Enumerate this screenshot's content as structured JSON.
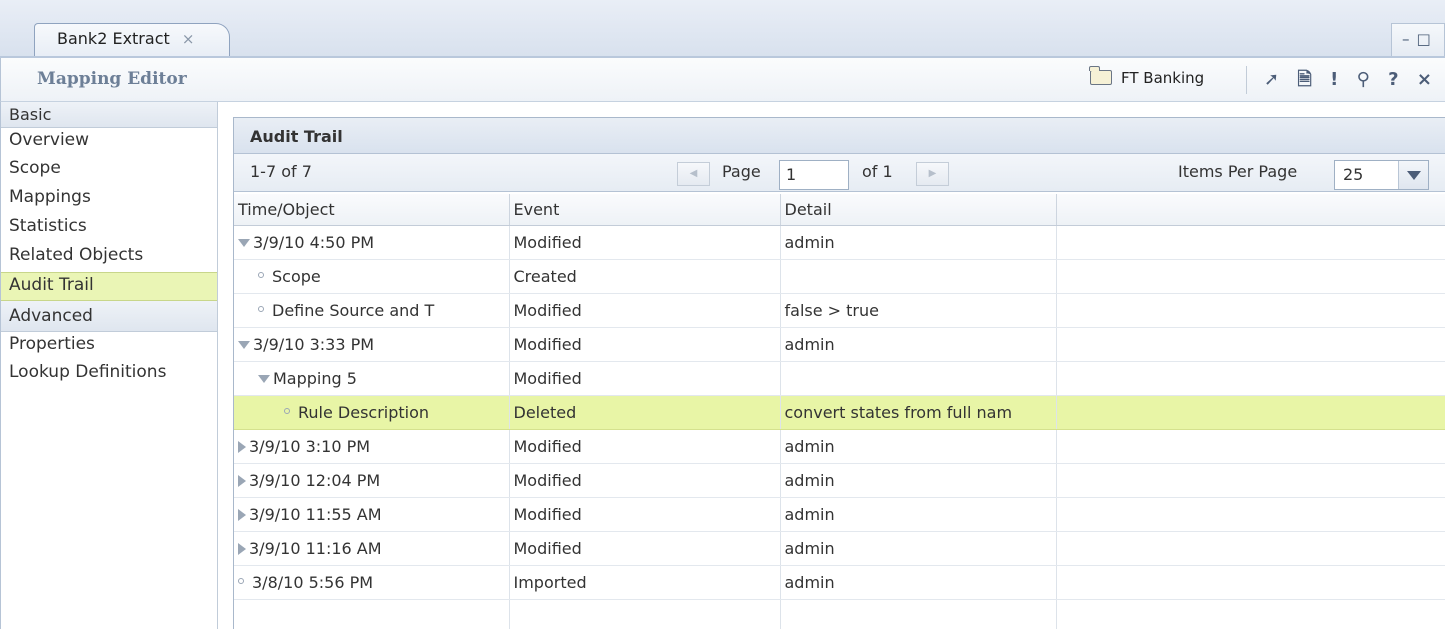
{
  "tab": {
    "title": "Bank2 Extract",
    "close_glyph": "×"
  },
  "window": {
    "minimize_glyph": "–",
    "maximize_glyph": "□"
  },
  "editor": {
    "title": "Mapping Editor",
    "project": "FT Banking",
    "tools": [
      {
        "icon": "arrow-icon",
        "glyph": "➚"
      },
      {
        "icon": "document-icon",
        "glyph": "🗎"
      },
      {
        "icon": "exclamation-icon",
        "glyph": "!"
      },
      {
        "icon": "search-icon",
        "glyph": "⚲"
      },
      {
        "icon": "help-icon",
        "glyph": "?"
      },
      {
        "icon": "close-icon",
        "glyph": "×"
      }
    ]
  },
  "sidebar": {
    "basic_header": "Basic",
    "basic_items": [
      "Overview",
      "Scope",
      "Mappings",
      "Statistics",
      "Related Objects",
      "Audit Trail"
    ],
    "selected": "Audit Trail",
    "advanced_header": "Advanced",
    "advanced_items": [
      "Properties",
      "Lookup Definitions"
    ]
  },
  "panel": {
    "title": "Audit Trail",
    "range": "1-7 of 7",
    "page_label": "Page",
    "page_value": "1",
    "of_label": "of 1",
    "ipp_label": "Items Per Page",
    "ipp_value": "25"
  },
  "grid": {
    "columns": [
      "Time/Object",
      "Event",
      "Detail",
      ""
    ],
    "rows": [
      {
        "time": "3/9/10 4:50 PM",
        "event": "Modified",
        "detail": "admin",
        "level": 0,
        "marker": "expanded"
      },
      {
        "time": "Scope",
        "event": "Created",
        "detail": "",
        "level": 1,
        "marker": "leaf"
      },
      {
        "time": "Define Source and T",
        "event": "Modified",
        "detail": "false > true",
        "level": 1,
        "marker": "leaf"
      },
      {
        "time": "3/9/10 3:33 PM",
        "event": "Modified",
        "detail": "admin",
        "level": 0,
        "marker": "expanded"
      },
      {
        "time": "Mapping 5",
        "event": "Modified",
        "detail": "",
        "level": 1,
        "marker": "expanded"
      },
      {
        "time": "Rule Description",
        "event": "Deleted",
        "detail": "convert states from full nam",
        "level": 2,
        "marker": "leaf",
        "highlight": true
      },
      {
        "time": "3/9/10 3:10 PM",
        "event": "Modified",
        "detail": "admin",
        "level": 0,
        "marker": "collapsed"
      },
      {
        "time": "3/9/10 12:04 PM",
        "event": "Modified",
        "detail": "admin",
        "level": 0,
        "marker": "collapsed"
      },
      {
        "time": "3/9/10 11:55 AM",
        "event": "Modified",
        "detail": "admin",
        "level": 0,
        "marker": "collapsed"
      },
      {
        "time": "3/9/10 11:16 AM",
        "event": "Modified",
        "detail": "admin",
        "level": 0,
        "marker": "collapsed"
      },
      {
        "time": "3/8/10 5:56 PM",
        "event": "Imported",
        "detail": "admin",
        "level": 0,
        "marker": "leaf"
      }
    ]
  },
  "colors": {
    "selection": "#e8f5a6",
    "header_text": "#6d7f97"
  }
}
